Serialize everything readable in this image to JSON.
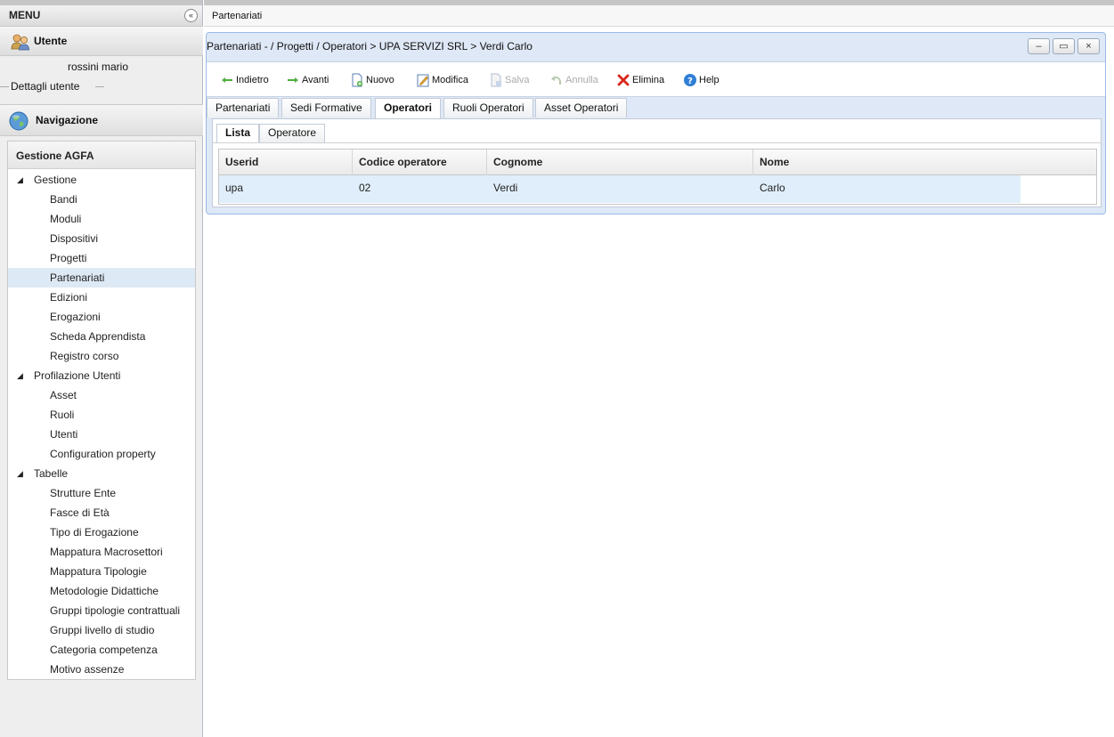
{
  "menu": {
    "title": "MENU",
    "collapse_icon": "«",
    "user_section": {
      "title": "Utente",
      "user_name": "rossini mario",
      "details_label": "Dettagli utente"
    },
    "nav_section": {
      "title": "Navigazione",
      "panel_title": "Gestione AGFA"
    },
    "tree": [
      {
        "label": "Gestione",
        "type": "group"
      },
      {
        "label": "Bandi",
        "type": "leaf"
      },
      {
        "label": "Moduli",
        "type": "leaf"
      },
      {
        "label": "Dispositivi",
        "type": "leaf"
      },
      {
        "label": "Progetti",
        "type": "leaf"
      },
      {
        "label": "Partenariati",
        "type": "leaf",
        "selected": true
      },
      {
        "label": "Edizioni",
        "type": "leaf"
      },
      {
        "label": "Erogazioni",
        "type": "leaf"
      },
      {
        "label": "Scheda Apprendista",
        "type": "leaf"
      },
      {
        "label": "Registro corso",
        "type": "leaf"
      },
      {
        "label": "Profilazione Utenti",
        "type": "group"
      },
      {
        "label": "Asset",
        "type": "leaf"
      },
      {
        "label": "Ruoli",
        "type": "leaf"
      },
      {
        "label": "Utenti",
        "type": "leaf"
      },
      {
        "label": "Configuration property",
        "type": "leaf"
      },
      {
        "label": "Tabelle",
        "type": "group"
      },
      {
        "label": "Strutture Ente",
        "type": "leaf"
      },
      {
        "label": "Fasce di Età",
        "type": "leaf"
      },
      {
        "label": "Tipo di Erogazione",
        "type": "leaf"
      },
      {
        "label": "Mappatura Macrosettori",
        "type": "leaf"
      },
      {
        "label": "Mappatura Tipologie",
        "type": "leaf"
      },
      {
        "label": "Metodologie Didattiche",
        "type": "leaf"
      },
      {
        "label": "Gruppi tipologie contrattuali",
        "type": "leaf"
      },
      {
        "label": "Gruppi livello di studio",
        "type": "leaf"
      },
      {
        "label": "Categoria competenza",
        "type": "leaf"
      },
      {
        "label": "Motivo assenze",
        "type": "leaf"
      }
    ]
  },
  "main": {
    "header_title": "Partenariati",
    "window": {
      "title": "Partenariati - / Progetti / Operatori > UPA SERVIZI SRL > Verdi Carlo",
      "btn_minimize": "–",
      "btn_maximize": "▭",
      "btn_close": "×"
    },
    "toolbar": {
      "back": "Indietro",
      "forward": "Avanti",
      "new": "Nuovo",
      "edit": "Modifica",
      "save": "Salva",
      "cancel": "Annulla",
      "delete": "Elimina",
      "help": "Help"
    },
    "tabs": [
      {
        "label": "Partenariati"
      },
      {
        "label": "Sedi Formative"
      },
      {
        "label": "Operatori",
        "active": true
      },
      {
        "label": "Ruoli Operatori"
      },
      {
        "label": "Asset Operatori"
      }
    ],
    "subtabs": [
      {
        "label": "Lista",
        "active": true
      },
      {
        "label": "Operatore"
      }
    ],
    "grid": {
      "columns": [
        "Userid",
        "Codice operatore",
        "Cognome",
        "Nome"
      ],
      "rows": [
        [
          "upa",
          "02",
          "Verdi",
          "Carlo"
        ]
      ]
    }
  },
  "colors": {
    "selected_row": "#dfeefa",
    "window_bg": "#dfe8f6",
    "window_border": "#99bbe8"
  }
}
